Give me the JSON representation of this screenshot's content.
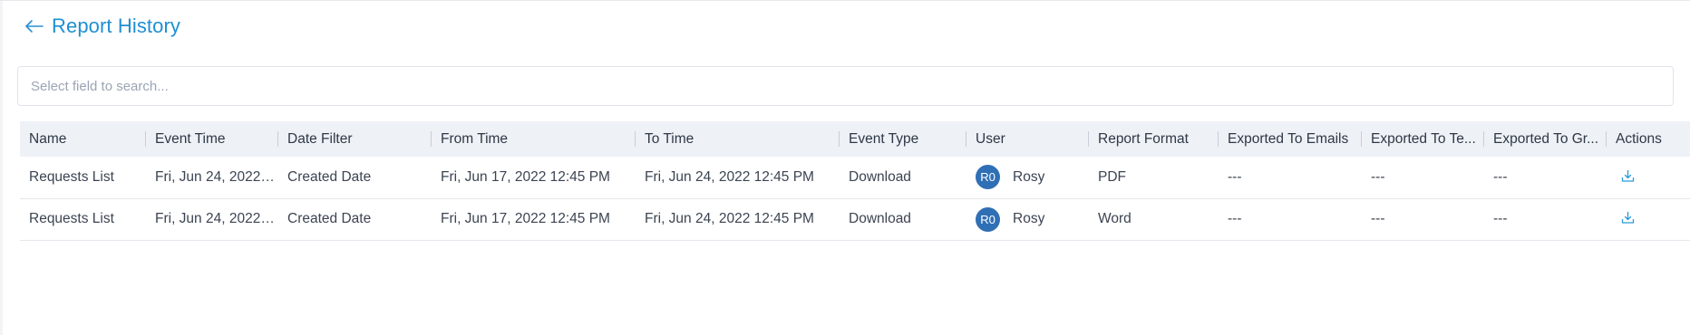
{
  "header": {
    "back_icon": "arrow-left-icon",
    "title": "Report History"
  },
  "search": {
    "placeholder": "Select field to search...",
    "value": ""
  },
  "table": {
    "columns": [
      "Name",
      "Event Time",
      "Date Filter",
      "From Time",
      "To Time",
      "Event Type",
      "User",
      "Report Format",
      "Exported To Emails",
      "Exported To Te...",
      "Exported To Gr...",
      "Actions"
    ],
    "rows": [
      {
        "name": "Requests List",
        "event_time": "Fri, Jun 24, 2022 1...",
        "date_filter": "Created Date",
        "from_time": "Fri, Jun 17, 2022 12:45 PM",
        "to_time": "Fri, Jun 24, 2022 12:45 PM",
        "event_type": "Download",
        "user_initials": "R0",
        "user_name": "Rosy",
        "report_format": "PDF",
        "exported_emails": "---",
        "exported_teams": "---",
        "exported_groups": "---",
        "action_icon": "download-icon"
      },
      {
        "name": "Requests List",
        "event_time": "Fri, Jun 24, 2022 1...",
        "date_filter": "Created Date",
        "from_time": "Fri, Jun 17, 2022 12:45 PM",
        "to_time": "Fri, Jun 24, 2022 12:45 PM",
        "event_type": "Download",
        "user_initials": "R0",
        "user_name": "Rosy",
        "report_format": "Word",
        "exported_emails": "---",
        "exported_teams": "---",
        "exported_groups": "---",
        "action_icon": "download-icon"
      }
    ]
  },
  "colors": {
    "accent": "#1f8fd3",
    "avatar_bg": "#2f6fb5",
    "header_bg": "#eef1f6"
  }
}
